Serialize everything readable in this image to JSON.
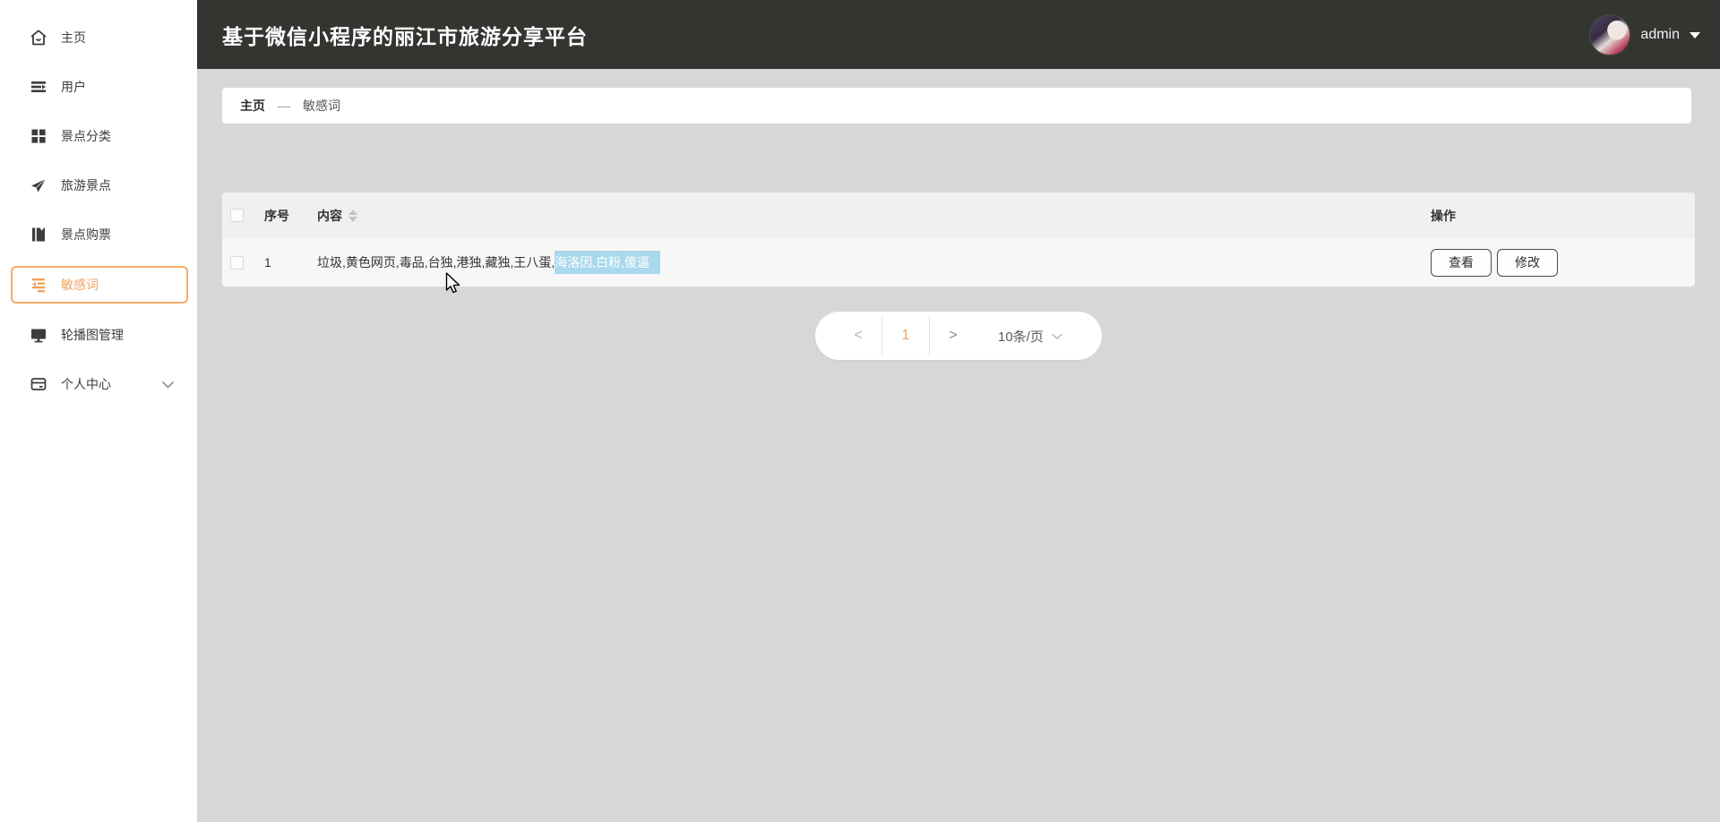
{
  "header": {
    "title": "基于微信小程序的丽江市旅游分享平台",
    "user": {
      "name": "admin"
    }
  },
  "sidebar": {
    "items": [
      {
        "label": "主页",
        "icon": "home-icon"
      },
      {
        "label": "用户",
        "icon": "list-arrow-icon"
      },
      {
        "label": "景点分类",
        "icon": "grid-icon"
      },
      {
        "label": "旅游景点",
        "icon": "paper-plane-icon"
      },
      {
        "label": "景点购票",
        "icon": "book-icon"
      },
      {
        "label": "敏感词",
        "icon": "indent-left-icon",
        "active": true
      },
      {
        "label": "轮播图管理",
        "icon": "monitor-icon"
      },
      {
        "label": "个人中心",
        "icon": "card-icon",
        "expandable": true
      }
    ]
  },
  "breadcrumb": {
    "home": "主页",
    "separator": "—",
    "current": "敏感词"
  },
  "table": {
    "columns": {
      "index": "序号",
      "content": "内容",
      "actions": "操作"
    },
    "rows": [
      {
        "index": "1",
        "content_plain": "垃圾,黄色网页,毒品,台独,港独,藏独,王八蛋,",
        "content_selected": "海洛因,白粉,傻逼",
        "view_label": "查看",
        "edit_label": "修改"
      }
    ]
  },
  "pagination": {
    "prev": "<",
    "page": "1",
    "next": ">",
    "page_size": "10条/页"
  },
  "colors": {
    "accent_orange": "#efa35c",
    "accent_border": "#f3ab68",
    "selection_blue": "#a9d9ec",
    "header_bg": "#333531",
    "content_bg": "#d7d7d7",
    "table_head_bg": "#f0f0f0",
    "table_row_bg": "#f7f7f7"
  }
}
